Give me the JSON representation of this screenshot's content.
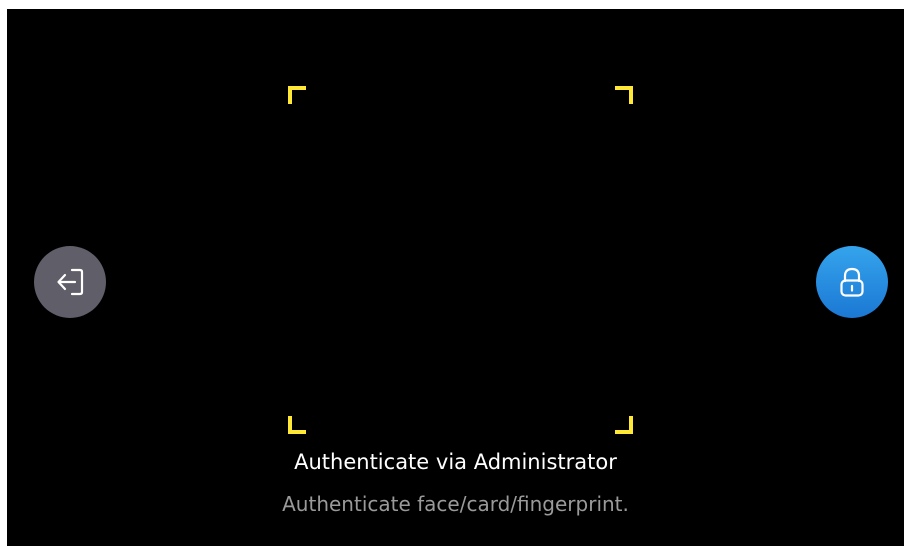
{
  "auth_screen": {
    "title": "Authenticate via Administrator",
    "subtitle": "Authenticate face/card/fingerprint.",
    "frame_color": "#ffe936",
    "exit_button": {
      "icon": "exit-arrow-icon",
      "color": "#5f5e69"
    },
    "lock_button": {
      "icon": "lock-icon",
      "color": "#1b78d4"
    }
  }
}
